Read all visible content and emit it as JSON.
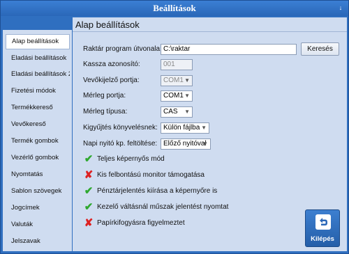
{
  "window": {
    "title": "Beállítások",
    "title_btn": "↓"
  },
  "sidebar": {
    "items": [
      {
        "label": "Alap beállítások",
        "active": true
      },
      {
        "label": "Eladási beállítások"
      },
      {
        "label": "Eladási beállítások 2"
      },
      {
        "label": "Fizetési módok"
      },
      {
        "label": "Termékkereső"
      },
      {
        "label": "Vevőkereső"
      },
      {
        "label": "Termék gombok"
      },
      {
        "label": "Vezérlő gombok"
      },
      {
        "label": "Nyomtatás"
      },
      {
        "label": "Sablon szövegek"
      },
      {
        "label": "Jogcímek"
      },
      {
        "label": "Valuták"
      },
      {
        "label": "Jelszavak"
      }
    ]
  },
  "main": {
    "title": "Alap beállítások",
    "warehouse_path": {
      "label": "Raktár program útvonala:",
      "value": "C:\\raktar",
      "search_label": "Keresés"
    },
    "cashier_id": {
      "label": "Kassza azonosító:",
      "value": "001"
    },
    "customer_display_port": {
      "label": "Vevőkijelző portja:",
      "value": "COM1"
    },
    "scale_port": {
      "label": "Mérleg portja:",
      "value": "COM1"
    },
    "scale_type": {
      "label": "Mérleg típusa:",
      "value": "CAS"
    },
    "collection_book": {
      "label": "Kigyűjtés könyvelésnek:",
      "value": "Külön fájlba"
    },
    "daily_opening": {
      "label": "Napi nyitó kp. feltöltése:",
      "value": "Előző nyitóval"
    },
    "checks": [
      {
        "label": "Teljes képernyős mód",
        "checked": true
      },
      {
        "label": "Kis felbontású monitor támogatása",
        "checked": false
      },
      {
        "label": "Pénztárjelentés kiírása a képernyőre is",
        "checked": true
      },
      {
        "label": "Kezelő váltásnál műszak jelentést nyomtat",
        "checked": true
      },
      {
        "label": "Papírkifogyásra figyelmeztet",
        "checked": false
      }
    ],
    "back_label": "Kilépés"
  },
  "icons": {
    "checked": "check-icon",
    "unchecked": "cross-icon",
    "back": "back-arrow-icon"
  },
  "colors": {
    "title_bar": "#2f6fc0",
    "panel": "#cfdcf0",
    "check": "#2fa82f",
    "cross": "#d22222"
  }
}
